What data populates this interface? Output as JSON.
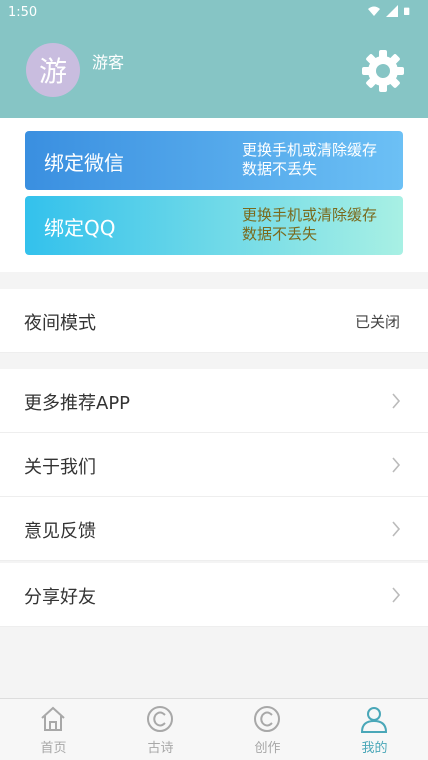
{
  "status_bar": {
    "time": "1:50"
  },
  "header": {
    "avatar_char": "游",
    "username": "游客"
  },
  "bind_cards": {
    "wechat": {
      "title": "绑定微信",
      "desc_line1": "更换手机或清除缓存",
      "desc_line2": "数据不丢失"
    },
    "qq": {
      "title": "绑定QQ",
      "desc_line1": "更换手机或清除缓存",
      "desc_line2": "数据不丢失"
    }
  },
  "night_mode": {
    "label": "夜间模式",
    "value": "已关闭"
  },
  "menu": [
    {
      "label": "更多推荐APP"
    },
    {
      "label": "关于我们"
    },
    {
      "label": "意见反馈"
    },
    {
      "label": "分享好友"
    }
  ],
  "bottom_nav": [
    {
      "label": "首页",
      "icon": "home-icon"
    },
    {
      "label": "古诗",
      "icon": "copyright-icon"
    },
    {
      "label": "创作",
      "icon": "copyright-icon"
    },
    {
      "label": "我的",
      "icon": "person-icon",
      "active": true
    }
  ],
  "colors": {
    "header_bg": "#86c5c5",
    "active_tab": "#4aa7b8",
    "inactive_tab": "#a8a8a8"
  }
}
